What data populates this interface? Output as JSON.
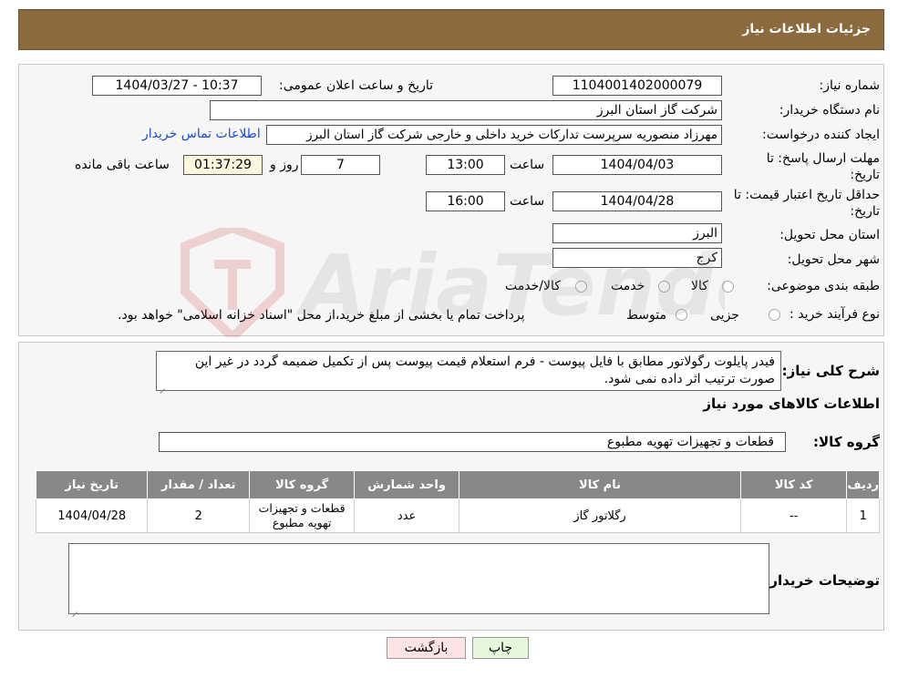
{
  "header": {
    "title": "جزئیات اطلاعات نیاز"
  },
  "form": {
    "need_number_label": "شماره نیاز:",
    "need_number": "1104001402000079",
    "announce_label": "تاریخ و ساعت اعلان عمومی:",
    "announce_value": "1404/03/27 - 10:37",
    "buyer_org_label": "نام دستگاه خریدار:",
    "buyer_org": "شرکت گاز استان البرز",
    "creator_label": "ایجاد کننده درخواست:",
    "creator": "مهرزاد منصوریه سرپرست تدارکات خرید داخلی و خارجی شرکت گاز استان البرز",
    "contact_link": "اطلاعات تماس خریدار",
    "deadline_label_1": "مهلت ارسال پاسخ: تا",
    "deadline_label_2": "تاریخ:",
    "deadline_date": "1404/04/03",
    "time_label": "ساعت",
    "deadline_time": "13:00",
    "days": "7",
    "days_label": "روز و",
    "remaining": "01:37:29",
    "remaining_label": "ساعت باقی مانده",
    "validity_label_1": "حداقل تاریخ اعتبار قیمت: تا",
    "validity_label_2": "تاریخ:",
    "validity_date": "1404/04/28",
    "validity_time": "16:00",
    "province_label": "استان محل تحویل:",
    "province": "البرز",
    "city_label": "شهر محل تحویل:",
    "city": "کرج",
    "category_label": "طبقه بندی موضوعی:",
    "category_options": [
      "کالا",
      "خدمت",
      "کالا/خدمت"
    ],
    "process_label": "نوع فرآیند خرید :",
    "process_options": [
      "جزیی",
      "متوسط"
    ],
    "process_note": "پرداخت تمام یا بخشی از مبلغ خرید،از محل \"اسناد خزانه اسلامی\" خواهد بود."
  },
  "details": {
    "summary_label": "شرح کلی نیاز:",
    "summary": "فیدر پایلوت رگولاتور مطابق با فایل پیوست - فرم استعلام قیمت پیوست پس از تکمیل ضمیمه گردد در غیر این صورت ترتیب اثر داده نمی شود.",
    "goods_info_title": "اطلاعات کالاهای مورد نیاز",
    "goods_group_label": "گروه کالا:",
    "goods_group": "قطعات و تجهیزات تهویه مطبوع",
    "table": {
      "headers": [
        "ردیف",
        "کد کالا",
        "نام کالا",
        "واحد شمارش",
        "گروه کالا",
        "تعداد / مقدار",
        "تاریخ نیاز"
      ],
      "rows": [
        [
          "1",
          "--",
          "رگلاتور گاز",
          "عدد",
          "قطعات و تجهیزات تهویه مطبوع",
          "2",
          "1404/04/28"
        ]
      ]
    },
    "buyer_notes_label": "توضیحات خریدار:",
    "buyer_notes": ""
  },
  "buttons": {
    "print": "چاپ",
    "back": "بازگشت"
  },
  "colors": {
    "header": "#8b6a3e",
    "table_header": "#888888",
    "link": "#1a4bd6",
    "back_button": "#fde3e3",
    "print_button": "#e6f7dc"
  }
}
